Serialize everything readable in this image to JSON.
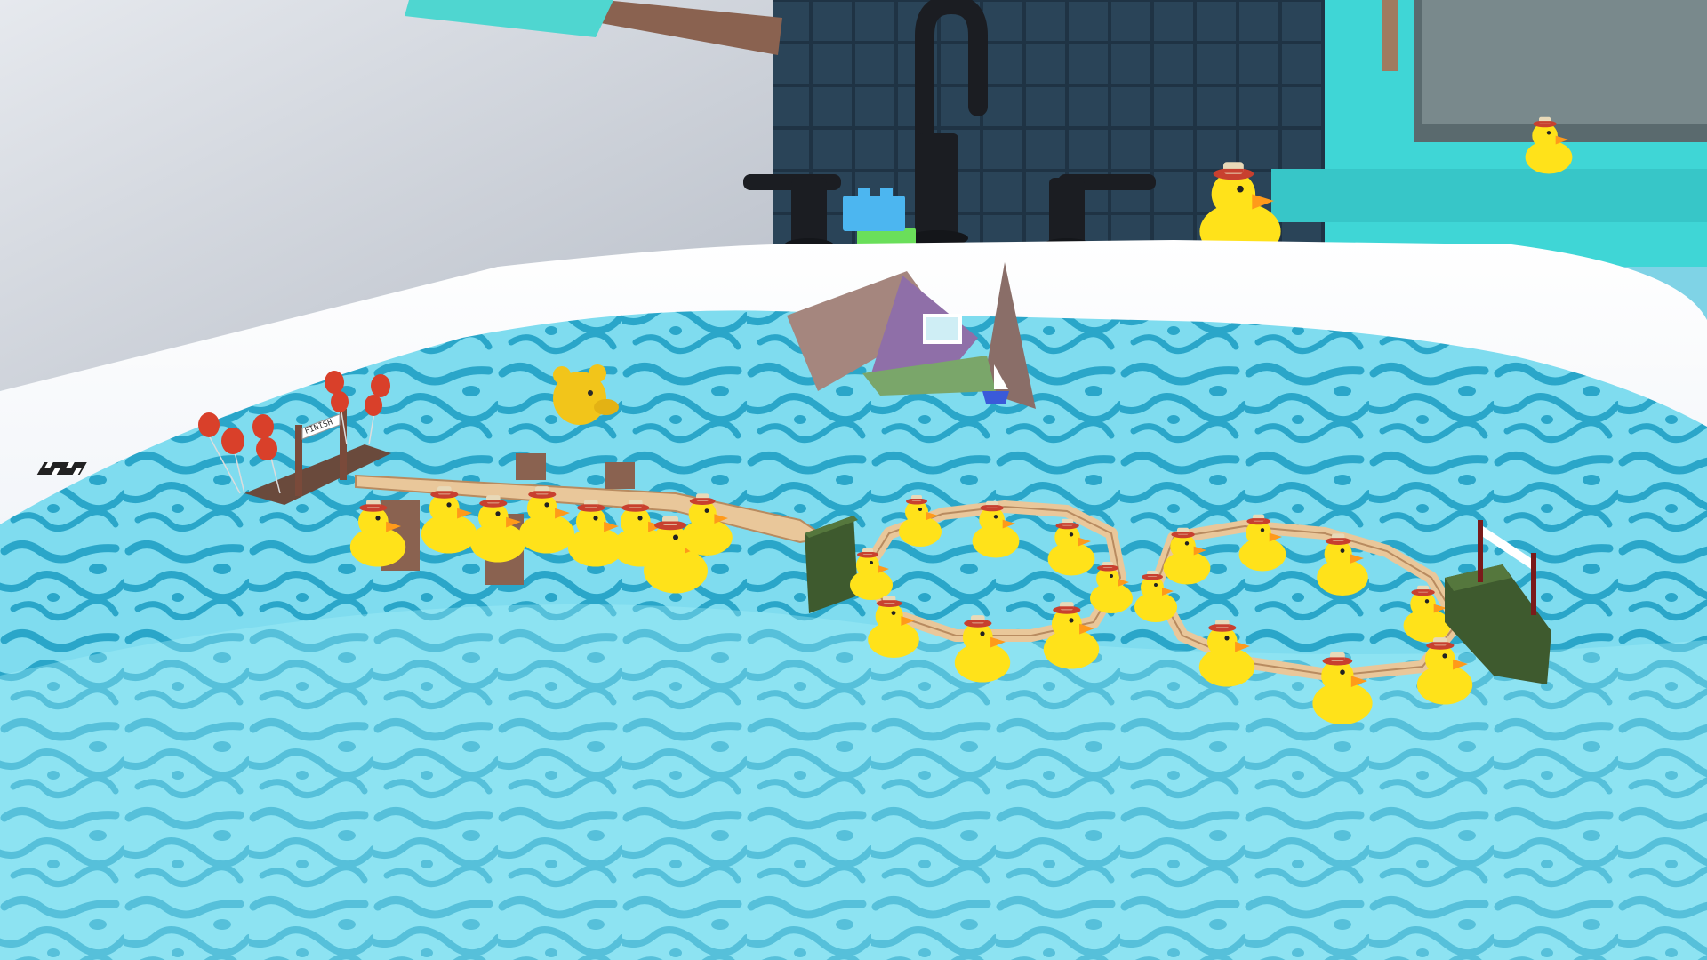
{
  "scene": {
    "finish_banner": "FINISH"
  },
  "palette": {
    "water_light": "#8fe8f5",
    "water_dark": "#4fc6e0",
    "water_pattern": "#2aa6c9",
    "tub_white": "#ffffff",
    "tub_shadow": "#dfe6f0",
    "wall_grey": "#c9ced6",
    "tile_dark": "#1f3344",
    "tile_grout": "#4d6b80",
    "window_teal": "#3fd6d6",
    "duck_yellow": "#ffe21a",
    "duck_orange": "#ff9a1a",
    "hat_red": "#c8402f",
    "wood_plank": "#e9c79a",
    "wood_post": "#8a6250",
    "green_block": "#3e5a2e",
    "balloon_red": "#d9402a"
  },
  "icons": {
    "faucet": "faucet-icon",
    "tap_handle": "tap-handle-icon",
    "rubber_duck": "rubber-duck-icon",
    "teddy_bear": "teddy-bear-head-icon",
    "toy_blocks": "toy-block-icon",
    "sailboat": "sailboat-icon",
    "balloon": "balloon-icon",
    "flag": "checkered-flag-icon"
  }
}
